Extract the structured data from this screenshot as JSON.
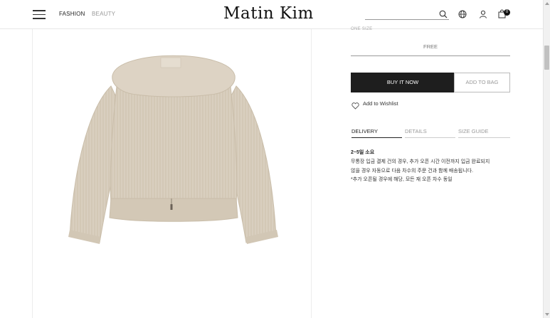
{
  "header": {
    "nav": {
      "fashion": "FASHION",
      "beauty": "BEAUTY"
    },
    "logo": "Matin Kim",
    "search": {
      "placeholder": ""
    },
    "icons": [
      "hamburger-menu-icon",
      "search-icon",
      "globe-icon",
      "user-icon",
      "shopping-bag-icon"
    ],
    "bag_count": "0"
  },
  "product": {
    "size_label": "ONE SIZE",
    "size_value": "FREE",
    "buy_now": "BUY IT NOW",
    "add_to_bag": "ADD TO BAG",
    "wishlist": "Add to Wishlist",
    "image_alt_icon": "knit-sweater-image"
  },
  "tabs": [
    "DELIVERY",
    "DETAILS",
    "SIZE GUIDE"
  ],
  "delivery": {
    "title": "2~5일 소요",
    "lines": [
      "무통장 입금 결제 건의 경우, 추가 오픈 시간 이전까지 입금 완료되지",
      "않을 경우 자동으로 다음 차수의 주문 건과 함께 배송됩니다.",
      "*추가 오픈될 경우에 해당, 모든 재 오픈 차수 동일"
    ]
  },
  "colors": {
    "buy_button_bg": "#1e1e1e",
    "sweater": "#d8cdbc",
    "border": "#e6e6e6"
  }
}
